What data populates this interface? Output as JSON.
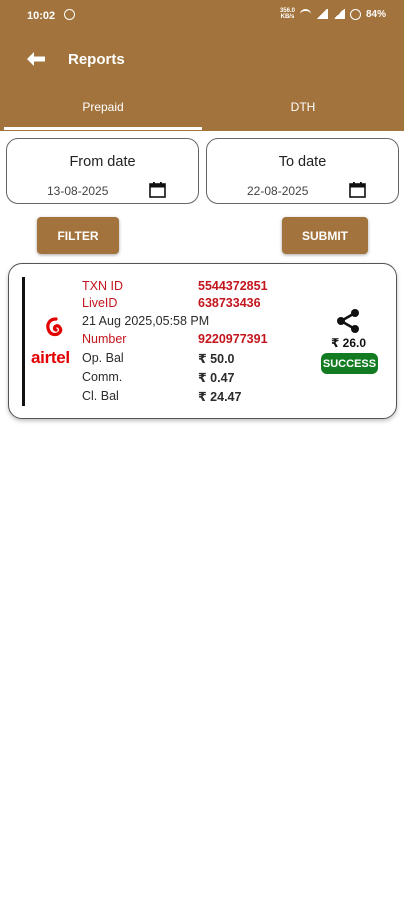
{
  "status_bar": {
    "time": "10:02",
    "speed": "356.0",
    "speed_unit": "KB/s",
    "battery": "84%"
  },
  "header": {
    "title": "Reports"
  },
  "tabs": [
    {
      "label": "Prepaid",
      "active": true
    },
    {
      "label": "DTH",
      "active": false
    }
  ],
  "filters": {
    "from_label": "From date",
    "from_value": "13-08-2025",
    "to_label": "To date",
    "to_value": "22-08-2025",
    "filter_label": "FILTER",
    "submit_label": "SUBMIT"
  },
  "transaction": {
    "operator_logo_text": "airtel",
    "txn_label": "TXN ID",
    "txn_value": "5544372851",
    "live_label": "LiveID",
    "live_value": "638733436",
    "datetime": "21 Aug 2025,05:58 PM",
    "number_label": "Number",
    "number_value": "9220977391",
    "opbal_label": "Op. Bal",
    "opbal_value": "₹ 50.0",
    "comm_label": "Comm.",
    "comm_value": "₹ 0.47",
    "clbal_label": "Cl. Bal",
    "clbal_value": "₹ 24.47",
    "amount": "₹ 26.0",
    "status": "SUCCESS"
  },
  "colors": {
    "brand": "#a2733c",
    "success": "#137c22",
    "accent_red": "#c3151d"
  }
}
